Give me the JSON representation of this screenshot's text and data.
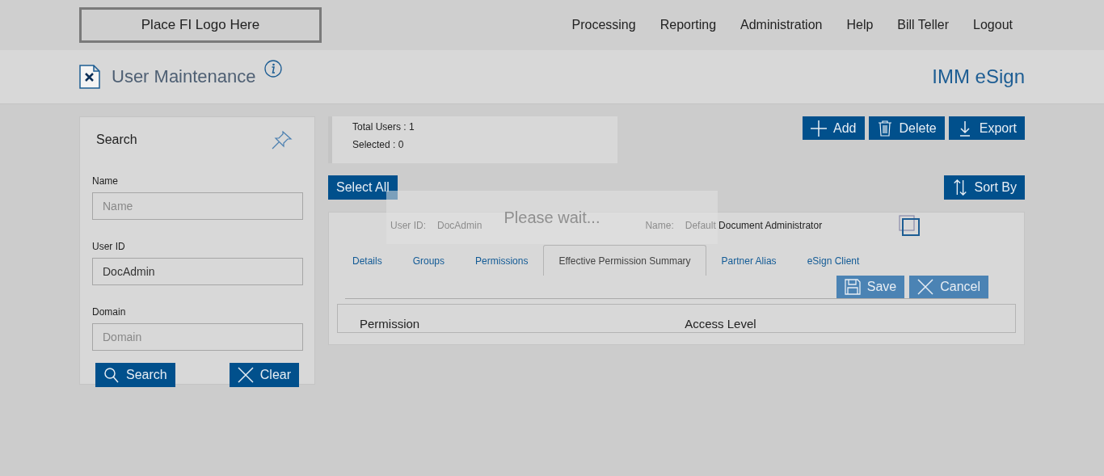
{
  "header": {
    "logo": "Place FI Logo Here",
    "nav": [
      "Processing",
      "Reporting",
      "Administration",
      "Help",
      "Bill Teller",
      "Logout"
    ]
  },
  "page": {
    "title": "User Maintenance",
    "app_name": "IMM eSign"
  },
  "search": {
    "title": "Search",
    "fields": [
      {
        "label": "Name",
        "placeholder": "Name"
      },
      {
        "label": "User ID",
        "value": "DocAdmin"
      },
      {
        "label": "Domain",
        "placeholder": "Domain"
      }
    ],
    "buttons": [
      {
        "kind": "search",
        "label": "Search"
      },
      {
        "kind": "clear",
        "label": "Clear"
      }
    ]
  },
  "summary": [
    "Total Users : 1",
    "Selected : 0"
  ],
  "toolbar": [
    {
      "kind": "add",
      "label": "Add"
    },
    {
      "kind": "delete",
      "label": "Delete"
    },
    {
      "kind": "export",
      "label": "Export"
    }
  ],
  "select_all": "Select All",
  "sort_by": {
    "kind": "sort",
    "label": "Sort By"
  },
  "user": {
    "user_id_label": "User ID:",
    "user_id": "DocAdmin",
    "name_label": "Name:",
    "name": "Default Document Administrator",
    "tabs": [
      {
        "label": "Details",
        "selected": false
      },
      {
        "label": "Groups",
        "selected": false
      },
      {
        "label": "Permissions",
        "selected": false
      },
      {
        "label": "Effective Permission Summary",
        "selected": true
      },
      {
        "label": "Partner Alias",
        "selected": false
      },
      {
        "label": "eSign Client",
        "selected": false
      }
    ],
    "actions": [
      {
        "kind": "save",
        "label": "Save"
      },
      {
        "kind": "cancel",
        "label": "Cancel"
      }
    ],
    "columns": [
      "Permission",
      "Access Level"
    ]
  },
  "loading": "Please wait..."
}
